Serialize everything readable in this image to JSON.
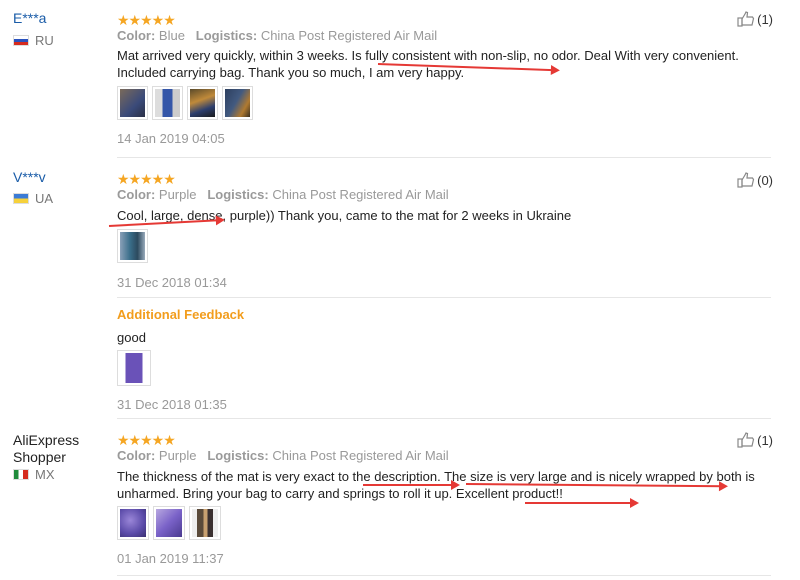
{
  "reviews": [
    {
      "user": "E***a",
      "country": "RU",
      "stars": "★★★★★",
      "color_label": "Color:",
      "color_value": "Blue",
      "logistics_label": "Logistics:",
      "logistics_value": "China Post Registered Air Mail",
      "text": "Mat arrived very quickly, within 3 weeks. Is fully consistent with non-slip, no odor. Deal With very convenient. Included carrying bag. Thank you so much, I am very happy.",
      "date": "14 Jan 2019 04:05",
      "useful": "(1)"
    },
    {
      "user": "V***v",
      "country": "UA",
      "stars": "★★★★★",
      "color_label": "Color:",
      "color_value": "Purple",
      "logistics_label": "Logistics:",
      "logistics_value": "China Post Registered Air Mail",
      "text": "Cool, large, dense, purple)) Thank you, came to the mat for 2 weeks in Ukraine",
      "date": "31 Dec 2018 01:34",
      "useful": "(0)",
      "additional": {
        "title": "Additional Feedback",
        "text": "good",
        "date": "31 Dec 2018 01:35"
      }
    },
    {
      "user": "AliExpress Shopper",
      "country": "MX",
      "stars": "★★★★★",
      "color_label": "Color:",
      "color_value": "Purple",
      "logistics_label": "Logistics:",
      "logistics_value": "China Post Registered Air Mail",
      "text": "The thickness of the mat is very exact to the description. The size is very large and is nicely wrapped by both is unharmed. Bring your bag to carry and springs to roll it up. Excellent product!!",
      "date": "01 Jan 2019 11:37",
      "useful": "(1)"
    }
  ],
  "colors": {
    "username": "#1a5ca8",
    "stars": "#f5a623",
    "additional_title": "#f29d1d",
    "annotation_arrow": "#e53935"
  }
}
